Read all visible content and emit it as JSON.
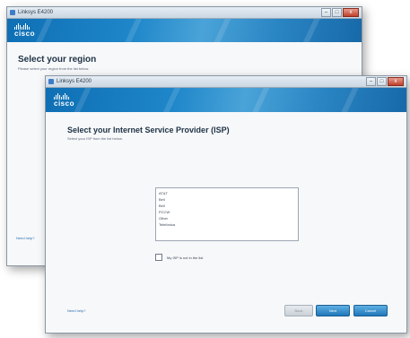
{
  "back_window": {
    "title": "Linksys E4200",
    "logo": "cisco",
    "heading": "Select your region",
    "subtext": "Please select your region from the list below.",
    "link": "Need help?"
  },
  "front_window": {
    "title": "Linksys E4200",
    "logo": "cisco",
    "heading": "Select your Internet Service Provider (ISP)",
    "subtext": "Select your ISP from the list below.",
    "isp_list": [
      "AT&T",
      "Bell",
      "Bell",
      "PCCW",
      "Other",
      "Telefónica"
    ],
    "checkbox_label": "My ISP is not in the list",
    "checkbox_checked": false,
    "link": "Need help?",
    "buttons": {
      "back": "Back",
      "next": "Next",
      "cancel": "Cancel"
    }
  },
  "window_controls": {
    "minimize": "–",
    "maximize": "□",
    "close": "x"
  }
}
